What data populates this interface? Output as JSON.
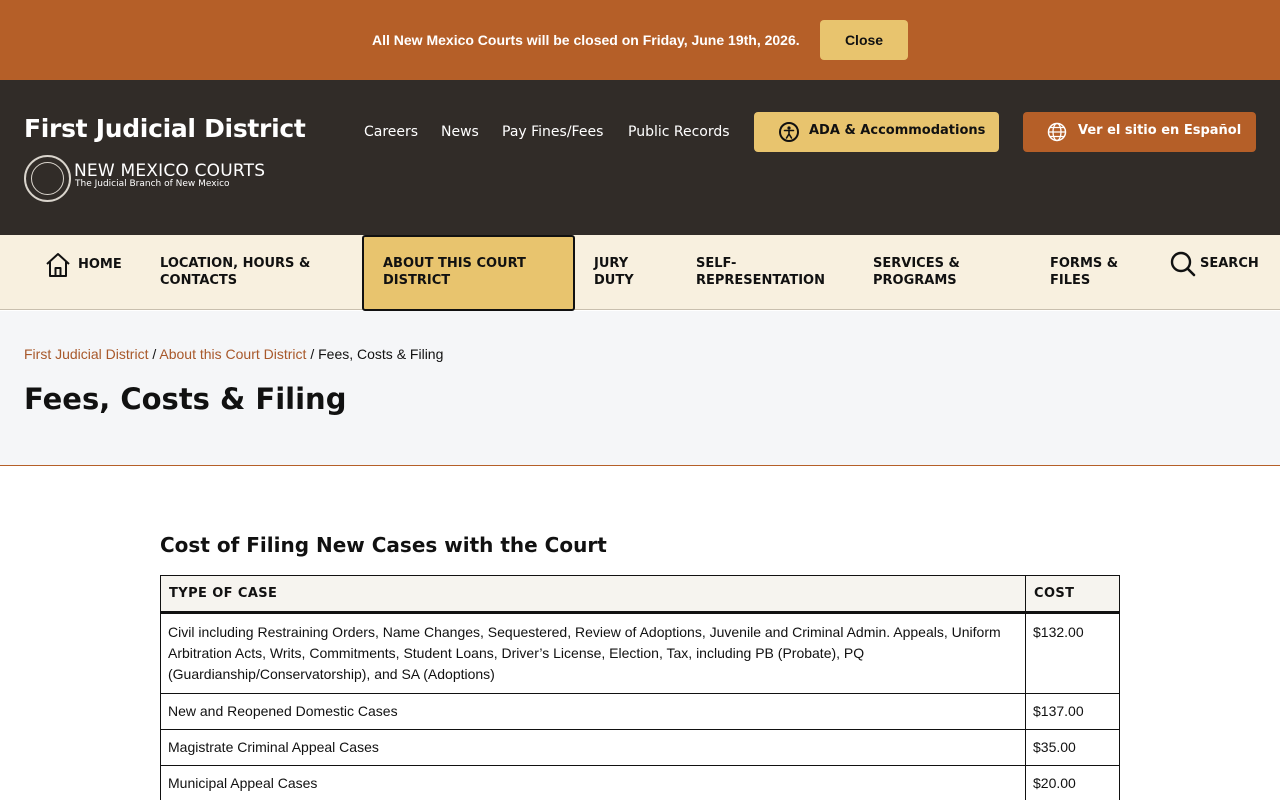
{
  "alert": {
    "message": "All New Mexico Courts will be closed on Friday, June 19th, 2026.",
    "close_label": "Close"
  },
  "header": {
    "site_title": "First Judicial District",
    "logo_title": "NEW MEXICO COURTS",
    "logo_subtitle": "The Judicial Branch of New Mexico",
    "links": [
      "Careers",
      "News",
      "Pay Fines/Fees",
      "Public Records"
    ],
    "ada_label": "ADA & Accommodations",
    "spanish_label": "Ver el sitio en Español"
  },
  "nav": {
    "home": "HOME",
    "location": "LOCATION, HOURS & CONTACTS",
    "about": "ABOUT THIS COURT DISTRICT",
    "jury": "JURY DUTY",
    "self_rep": "SELF-REPRESENTATION",
    "services": "SERVICES & PROGRAMS",
    "forms": "FORMS & FILES",
    "search": "SEARCH",
    "active": "ABOUT THIS COURT DISTRICT"
  },
  "breadcrumb": {
    "items": [
      "First Judicial District",
      "About this Court District"
    ],
    "separator": "/",
    "current": "Fees, Costs & Filing"
  },
  "page_title": "Fees, Costs & Filing",
  "section": {
    "heading": "Cost of Filing New Cases with the Court",
    "columns": [
      "TYPE OF CASE",
      "COST"
    ],
    "rows": [
      {
        "type": "Civil including Restraining Orders, Name Changes, Sequestered, Review of Adoptions, Juvenile and Criminal Admin. Appeals, Uniform Arbitration Acts, Writs, Commitments, Student Loans, Driver’s License, Election, Tax, including PB (Probate), PQ (Guardianship/Conservatorship), and SA (Adoptions)",
        "cost": "$132.00"
      },
      {
        "type": "New and Reopened Domestic Cases",
        "cost": "$137.00"
      },
      {
        "type": "Magistrate Criminal Appeal Cases",
        "cost": "$35.00"
      },
      {
        "type": "Municipal Appeal Cases",
        "cost": "$20.00"
      }
    ]
  },
  "colors": {
    "accent_orange": "#b55f28",
    "accent_gold": "#e8c46e",
    "header_dark": "#312c28",
    "nav_cream": "#f8f0df"
  }
}
